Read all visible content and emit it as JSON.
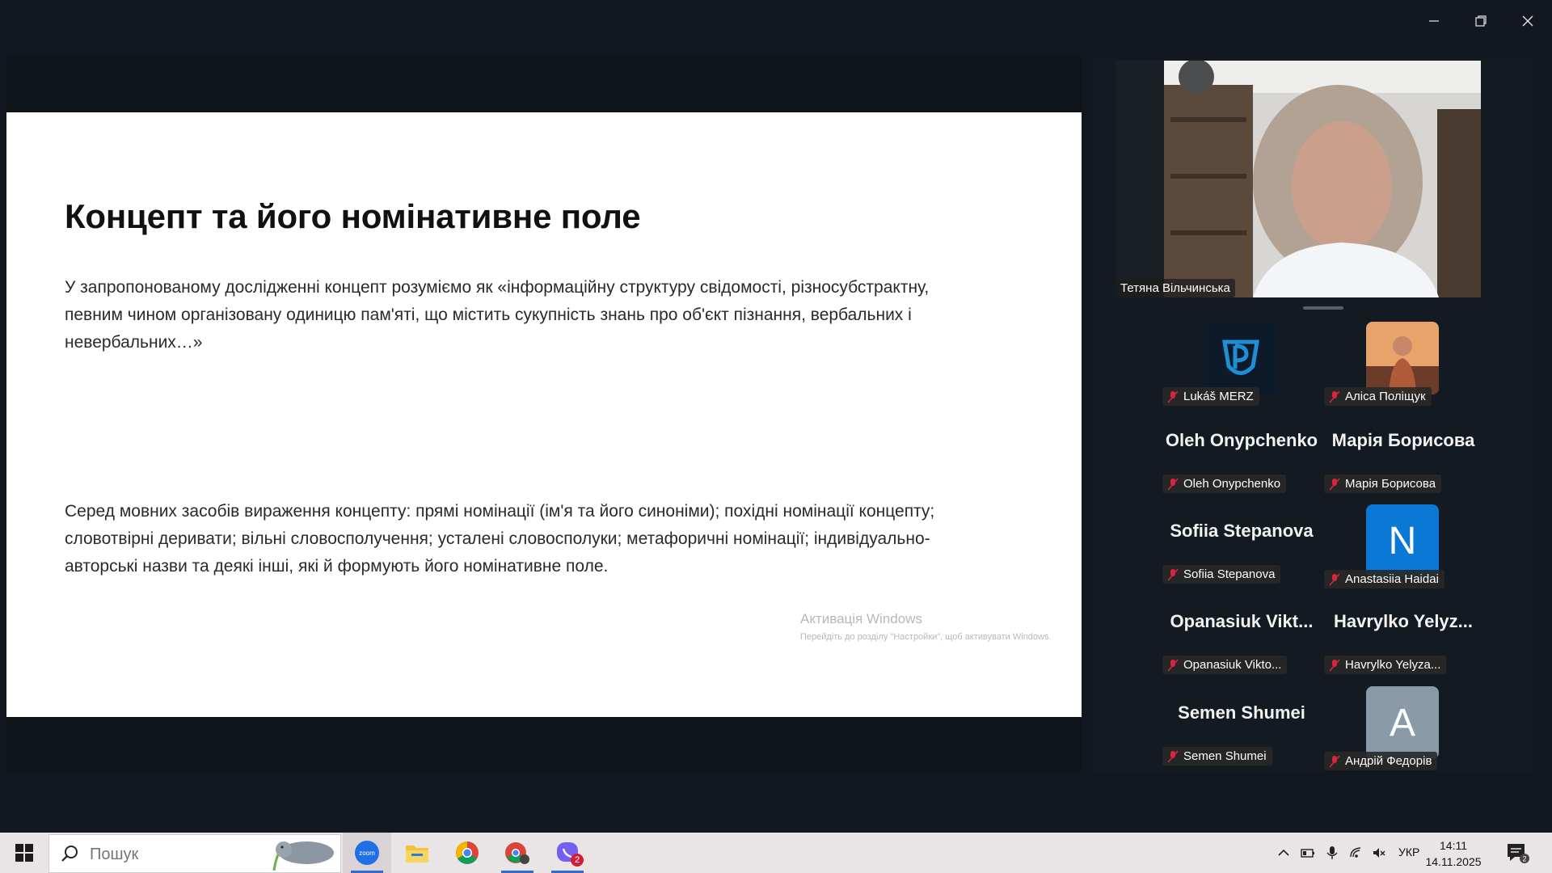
{
  "window": {
    "controls": {
      "minimize": "minimize",
      "restore": "restore",
      "close": "close"
    }
  },
  "slide": {
    "title": "Концепт та його номінативне поле",
    "paragraph1": "У запропонованому  дослідженні концепт розуміємо як «інформаційну структуру свідомості, різносубстрактну, певним чином організовану одиницю пам'яті, що містить сукупність знань про об'єкт пізнання, вербальних і невербальних…»",
    "paragraph2": "Серед мовних засобів вираження концепту: прямі номінації (ім'я та його синоніми); похідні номінації концепту; словотвірні деривати; вільні словосполучення; усталені словосполуки; метафоричні номінації; індивідуально-авторські назви та деякі інші, які й формують його номінативне поле."
  },
  "activation": {
    "title": "Активація Windows",
    "subtitle": "Перейдіть до розділу \"Настройки\", щоб активувати Windows."
  },
  "speaker": {
    "name": "Тетяна Вільчинська"
  },
  "participants": [
    {
      "name": "Lukáš MERZ",
      "display": "",
      "avatar": "logo"
    },
    {
      "name": "Аліса Поліщук",
      "display": "",
      "avatar": "photo"
    },
    {
      "name": "Oleh Onypchenko",
      "display": "Oleh Onypchenko",
      "avatar": ""
    },
    {
      "name": "Марія Борисова",
      "display": "Марія Борисова",
      "avatar": ""
    },
    {
      "name": "Sofiia Stepanova",
      "display": "Sofiia Stepanova",
      "avatar": ""
    },
    {
      "name": "Anastasiia Haidai",
      "display": "",
      "avatar": "N"
    },
    {
      "name": "Opanasiuk Vikto...",
      "display": "Opanasiuk  Vikt...",
      "avatar": ""
    },
    {
      "name": "Havrylko  Yelyza...",
      "display": "Havrylko   Yelyz...",
      "avatar": ""
    },
    {
      "name": "Semen Shumei",
      "display": "Semen Shumei",
      "avatar": ""
    },
    {
      "name": "Андрій Федорів",
      "display": "",
      "avatar": "A"
    }
  ],
  "colors": {
    "avatar_n": "#0a78d4",
    "avatar_a": "#8a9aa8",
    "mute": "#d7263d"
  },
  "taskbar": {
    "search_placeholder": "Пошук",
    "apps": [
      "zoom",
      "file-explorer",
      "chrome",
      "chrome-profile",
      "viber"
    ],
    "viber_badge": "2",
    "language": "УКР",
    "time": "14:11",
    "date": "14.11.2025",
    "notification_count": "2"
  }
}
